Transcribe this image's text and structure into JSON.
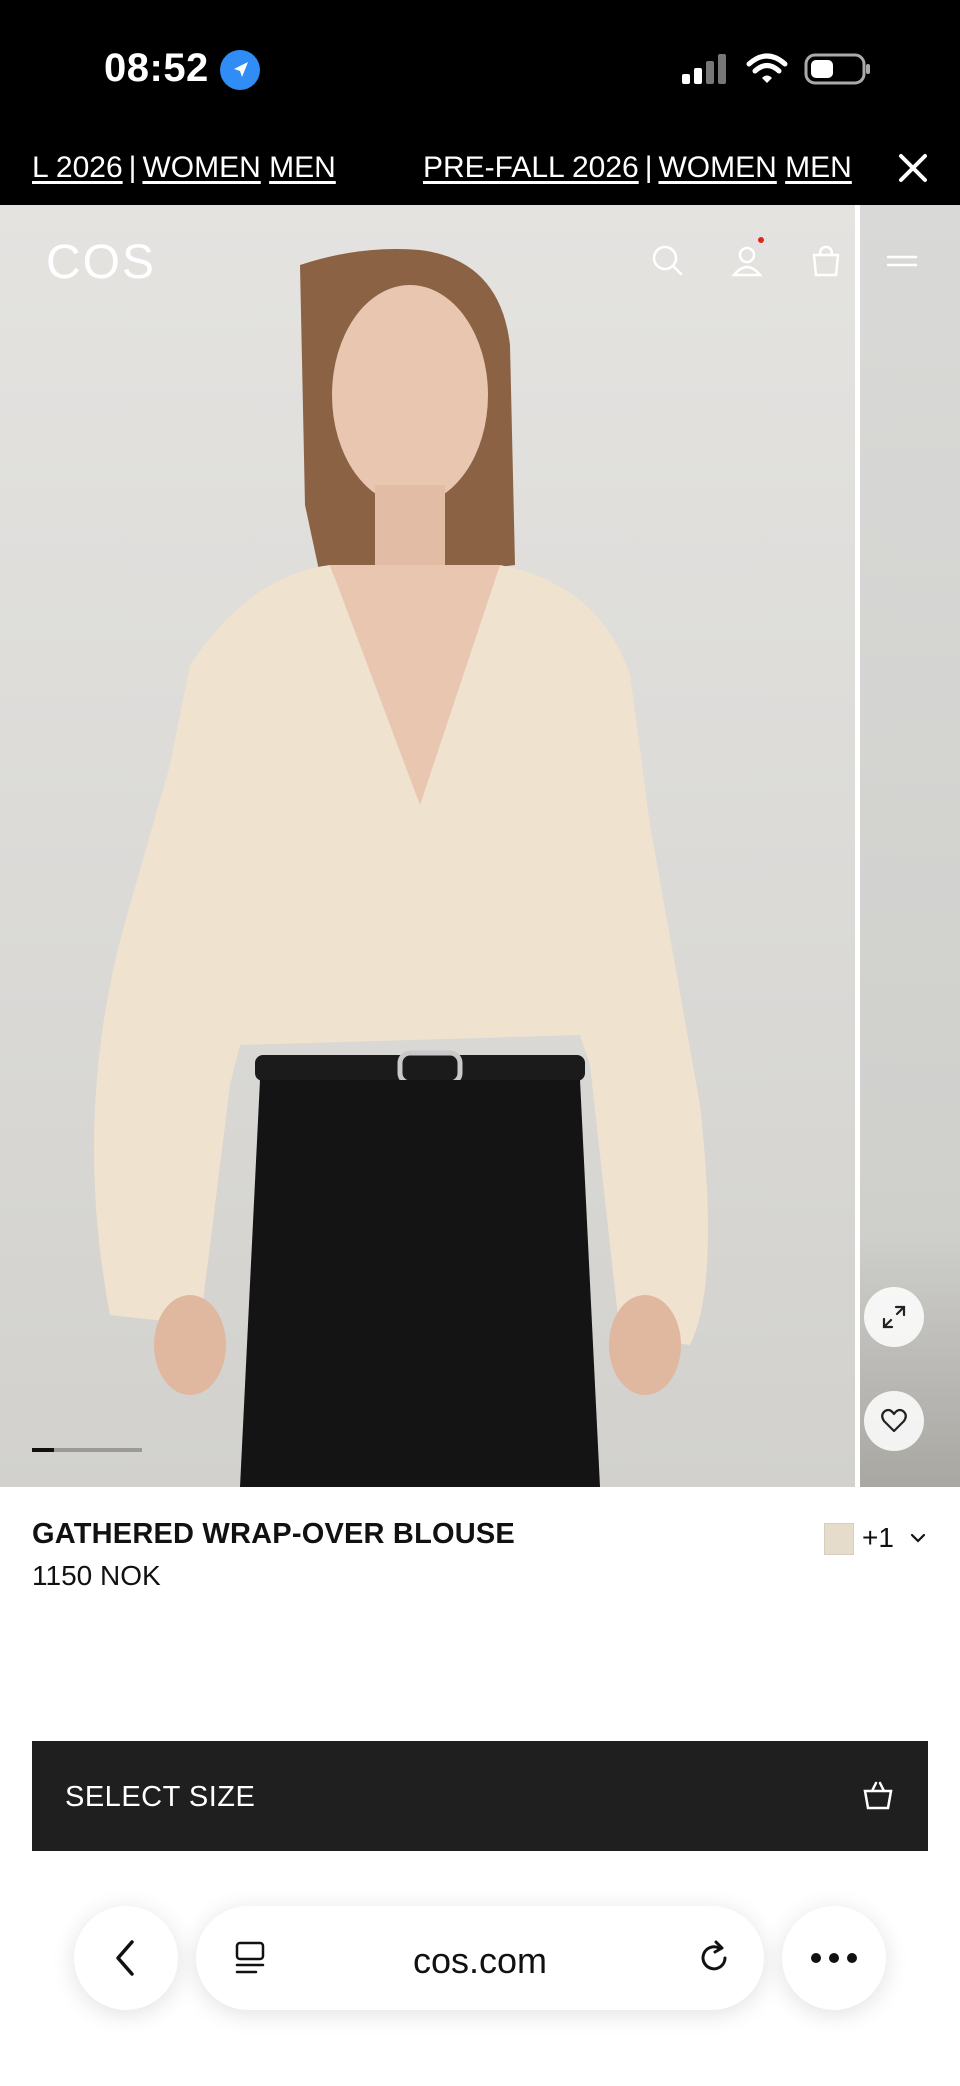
{
  "status_bar": {
    "time": "08:52"
  },
  "announcement": {
    "left_text": {
      "season": "L 2026",
      "women": "WOMEN",
      "men": "MEN"
    },
    "right_text": {
      "season": "PRE-FALL 2026",
      "women": "WOMEN",
      "men": "MEN"
    },
    "separator": "|"
  },
  "header": {
    "logo": "COS",
    "icons": [
      "search-icon",
      "account-icon",
      "bag-icon",
      "menu-icon"
    ]
  },
  "gallery": {
    "current_image": 1,
    "progress_fraction": 0.2
  },
  "product": {
    "name": "GATHERED WRAP-OVER BLOUSE",
    "price": "1150 NOK",
    "extra_colours": "+1",
    "swatch_color": "#e6dccb"
  },
  "cta": {
    "label": "SELECT SIZE"
  },
  "browser": {
    "url": "cos.com"
  },
  "colors": {
    "cta_bg": "#1f1f1f",
    "status_bg": "#000000",
    "location_badge": "#2f8df5"
  }
}
